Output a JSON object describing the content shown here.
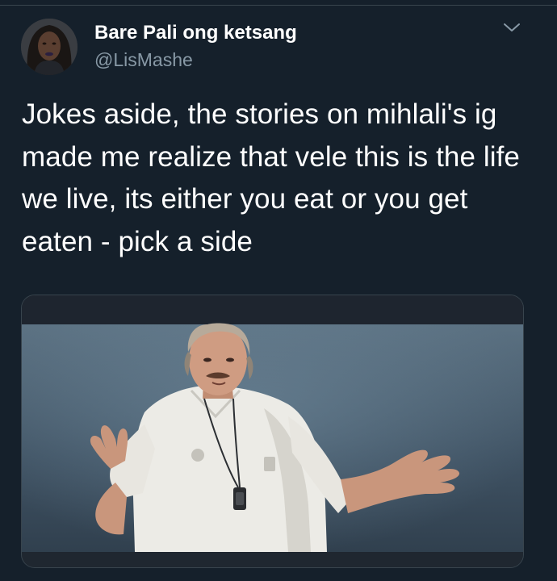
{
  "tweet": {
    "author_name": "Bare Pali ong ketsang",
    "author_handle": "@LisMashe",
    "text": "Jokes aside, the stories on mihlali's ig made me realize that vele this is the life we live, its either you eat or you get eaten - pick a side"
  },
  "icons": {
    "menu": "chevron-down-icon",
    "avatar": "profile-avatar"
  },
  "colors": {
    "background": "#15202b",
    "primary_text": "#ffffff",
    "secondary_text": "#8899a6",
    "divider": "#38444d"
  }
}
